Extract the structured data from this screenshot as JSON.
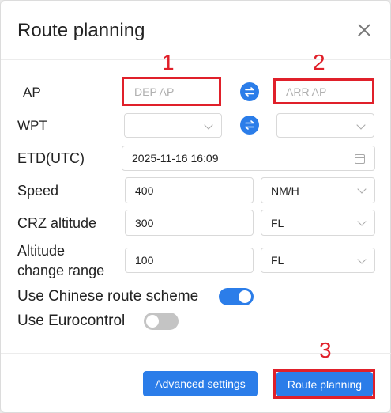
{
  "dialog": {
    "title": "Route planning",
    "close_icon": "close-icon"
  },
  "rows": {
    "ap": {
      "label": "AP",
      "dep_placeholder": "DEP AP",
      "arr_placeholder": "ARR AP",
      "swap_icon": "swap-icon"
    },
    "wpt": {
      "label": "WPT",
      "swap_icon": "swap-icon"
    },
    "etd": {
      "label": "ETD(UTC)",
      "value": "2025-11-16 16:09",
      "icon": "calendar-icon"
    },
    "speed": {
      "label": "Speed",
      "value": "400",
      "unit": "NM/H"
    },
    "crz": {
      "label": "CRZ altitude",
      "value": "300",
      "unit": "FL"
    },
    "altitude_change": {
      "label_line1": "Altitude",
      "label_line2": "change range",
      "value": "100",
      "unit": "FL"
    }
  },
  "toggles": {
    "chinese": {
      "label": "Use Chinese route scheme",
      "state": "on"
    },
    "eurocontrol": {
      "label": "Use Eurocontrol",
      "state": "off"
    }
  },
  "footer": {
    "advanced_label": "Advanced settings",
    "route_label": "Route planning"
  },
  "annotations": {
    "n1": "1",
    "n2": "2",
    "n3": "3",
    "color": "#e0202a"
  },
  "colors": {
    "accent": "#2b7de9"
  }
}
